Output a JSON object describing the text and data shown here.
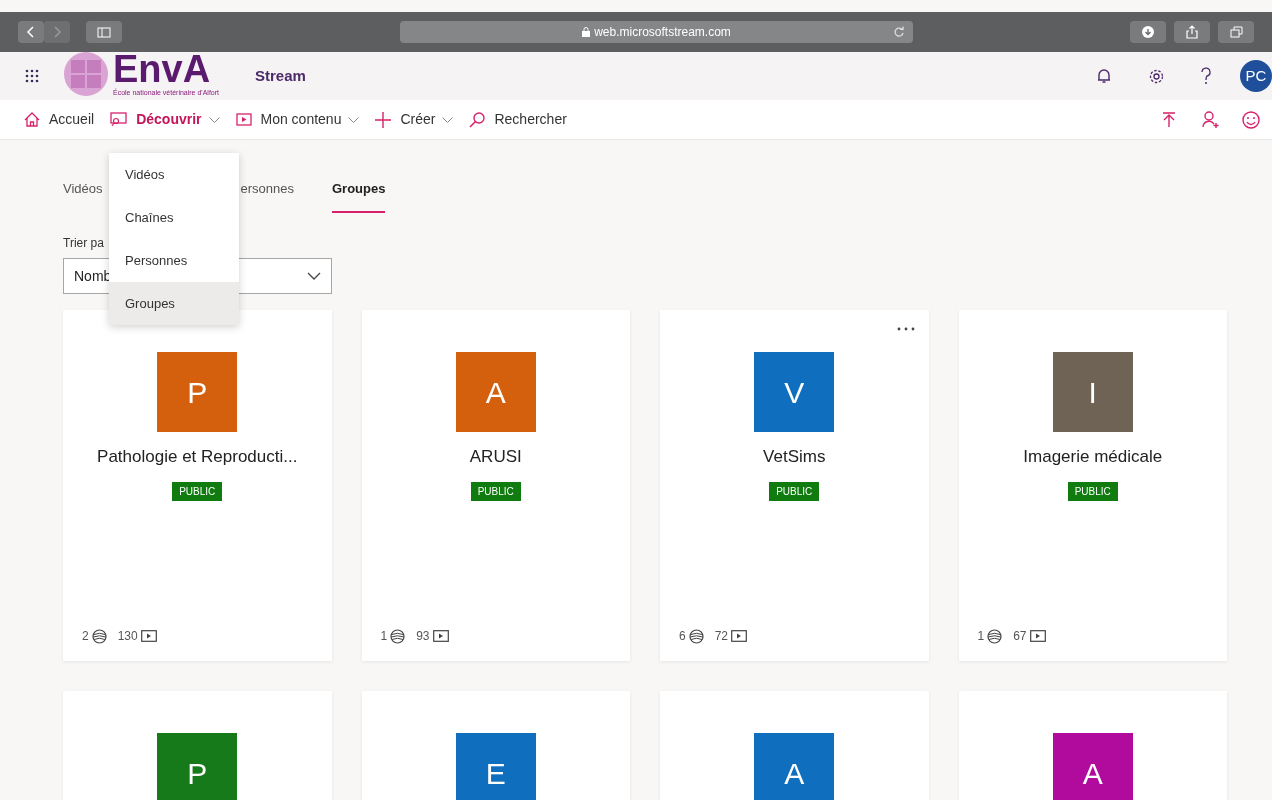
{
  "browser": {
    "url": "web.microsoftstream.com"
  },
  "header": {
    "logo_text": "EnvA",
    "logo_subtitle": "École nationale vétérinaire d'Alfort",
    "app_name": "Stream",
    "avatar": "PC"
  },
  "nav": [
    {
      "label": "Accueil",
      "selected": false,
      "dropdown": false
    },
    {
      "label": "Découvrir",
      "selected": true,
      "dropdown": true
    },
    {
      "label": "Mon contenu",
      "selected": false,
      "dropdown": true
    },
    {
      "label": "Créer",
      "selected": false,
      "dropdown": true
    },
    {
      "label": "Rechercher",
      "selected": false,
      "dropdown": false
    }
  ],
  "menu": [
    {
      "label": "Vidéos",
      "selected": false
    },
    {
      "label": "Chaînes",
      "selected": false
    },
    {
      "label": "Personnes",
      "selected": false
    },
    {
      "label": "Groupes",
      "selected": true
    }
  ],
  "tabs": [
    {
      "label": "Vidéos",
      "selected": false
    },
    {
      "label": "ersonnes",
      "selected": false
    },
    {
      "label": "Groupes",
      "selected": true
    }
  ],
  "sort": {
    "label": "Trier pa",
    "value": "Nomb"
  },
  "groups": [
    {
      "letter": "P",
      "color": "#d4600e",
      "name": "Pathologie et Reproducti...",
      "badge": "PUBLIC",
      "members": "2",
      "videos": "130",
      "more": false
    },
    {
      "letter": "A",
      "color": "#d4600e",
      "name": "ARUSI",
      "badge": "PUBLIC",
      "members": "1",
      "videos": "93",
      "more": false
    },
    {
      "letter": "V",
      "color": "#106ebe",
      "name": "VetSims",
      "badge": "PUBLIC",
      "members": "6",
      "videos": "72",
      "more": true
    },
    {
      "letter": "I",
      "color": "#6f6356",
      "name": "Imagerie médicale",
      "badge": "PUBLIC",
      "members": "1",
      "videos": "67",
      "more": false
    },
    {
      "letter": "P",
      "color": "#16791a",
      "more": false
    },
    {
      "letter": "E",
      "color": "#106ebe",
      "more": false
    },
    {
      "letter": "A",
      "color": "#106ebe",
      "more": false
    },
    {
      "letter": "A",
      "color": "#b10b9e",
      "more": false
    }
  ]
}
